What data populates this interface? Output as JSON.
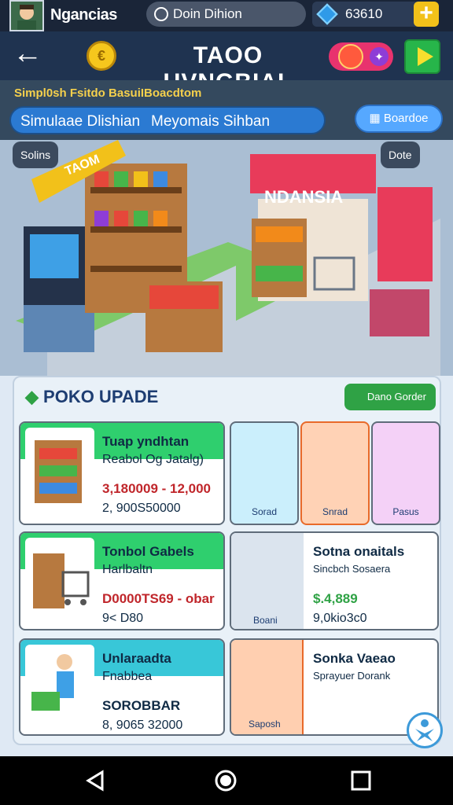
{
  "top": {
    "username": "Ngancias",
    "search": "Doin Dihion",
    "gems": "63610",
    "gem_icon": "gem-icon",
    "plus": "+"
  },
  "header": {
    "title": "TAOO UVNGBIAL",
    "coin_symbol": "€"
  },
  "subtitle": "Simpl0sh Fsitdo BasuiIBoacdtom",
  "bar": {
    "left": "Simulaae Dlishian",
    "right": "Meyomais Sihban"
  },
  "sub_button": "Boardoe",
  "scene": {
    "chip_left": "Solins",
    "chip_right": "Dote",
    "shop_sign": "NDANSIA",
    "kiosk_sign": "TAOM"
  },
  "panel": {
    "title": "POKO UPADE",
    "button": "Dano Gorder"
  },
  "items": [
    {
      "title": "Tuap yndhtan",
      "sub": "Reabol Og Jatalg)",
      "price": "3,180009 - 12,000",
      "qty": "2, 900S50000"
    },
    {
      "title": "Tonbol Gabels",
      "sub": "Harlbaltn",
      "price": "D0000TS69 - obar",
      "qty": "9< D80"
    },
    {
      "title": "Unlaraadta",
      "sub": "Fnabbea",
      "price": "SOROBBAR",
      "qty": "8, 9065 32000"
    }
  ],
  "tiles": [
    "Sorad",
    "Snrad",
    "Pasus"
  ],
  "side_cards": [
    {
      "title": "Sotna onaitals",
      "sub": "Sincbch Sosaera",
      "price": "$.4,889",
      "qty": "9,0kio3c0",
      "tag": "Boani"
    },
    {
      "title": "Sonka Vaeao",
      "sub": "Sprayuer Dorank",
      "tag": "Saposh"
    }
  ],
  "colors": {
    "accent": "#2b7ad2",
    "header": "#1f3350",
    "green": "#2fa245",
    "price_red": "#c0262b"
  }
}
